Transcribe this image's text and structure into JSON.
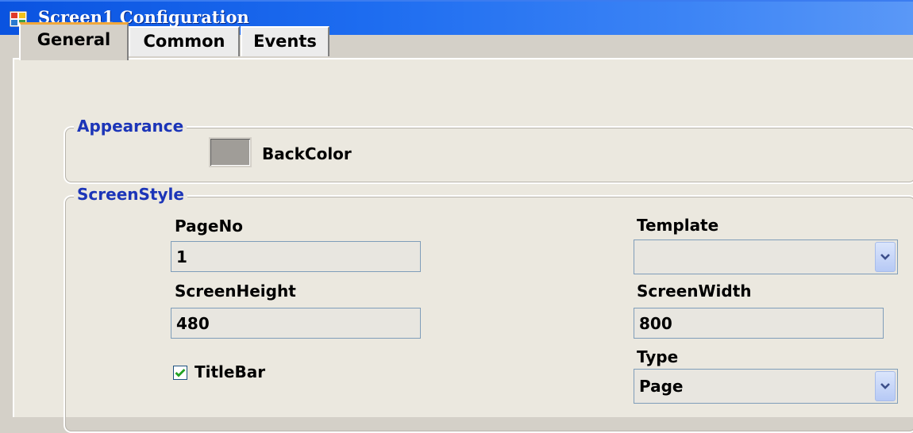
{
  "window": {
    "title": "Screen1 Configuration"
  },
  "tabs": [
    {
      "label": "General",
      "active": true
    },
    {
      "label": "Common",
      "active": false
    },
    {
      "label": "Events",
      "active": false
    }
  ],
  "appearance": {
    "legend": "Appearance",
    "backcolor_label": "BackColor",
    "backcolor_value": "#a09d98"
  },
  "screen_style": {
    "legend": "ScreenStyle",
    "page_no": {
      "label": "PageNo",
      "value": "1"
    },
    "template": {
      "label": "Template",
      "value": ""
    },
    "screen_height": {
      "label": "ScreenHeight",
      "value": "480"
    },
    "screen_width": {
      "label": "ScreenWidth",
      "value": "800"
    },
    "title_bar": {
      "label": "TitleBar",
      "checked": true
    },
    "type": {
      "label": "Type",
      "value": "Page"
    }
  },
  "colors": {
    "title_bar": "#1d6cf0",
    "legend_text": "#1c35b8",
    "active_tab_accent": "#f2a83a"
  }
}
